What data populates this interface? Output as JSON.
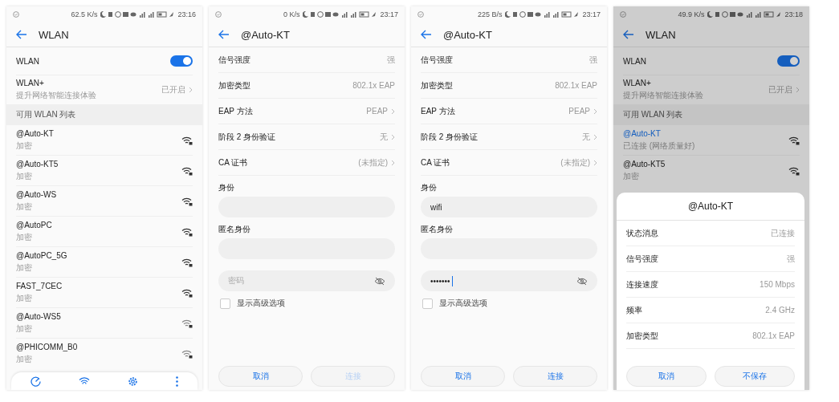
{
  "screens": [
    {
      "kind": "wlan_list",
      "dimmed": false,
      "status_bar": {
        "speed": "62.5 K/s",
        "time": "23:16"
      },
      "title": "WLAN",
      "wlan_toggle": {
        "label": "WLAN",
        "on": true
      },
      "wlan_plus": {
        "label": "WLAN+",
        "subtitle": "提升网络智能连接体验",
        "value": "已开启"
      },
      "section": "可用 WLAN 列表",
      "networks": [
        {
          "name": "@Auto-KT",
          "status": "加密",
          "connected": false
        },
        {
          "name": "@Auto-KT5",
          "status": "加密",
          "connected": false
        },
        {
          "name": "@Auto-WS",
          "status": "加密",
          "connected": false
        },
        {
          "name": "@AutoPC",
          "status": "加密",
          "connected": false
        },
        {
          "name": "@AutoPC_5G",
          "status": "加密",
          "connected": false
        },
        {
          "name": "FAST_7CEC",
          "status": "加密",
          "connected": false
        },
        {
          "name": "@Auto-WS5",
          "status": "加密",
          "connected": false
        },
        {
          "name": "@PHICOMM_B0",
          "status": "加密",
          "connected": false
        }
      ],
      "bottom_toolbar": true
    },
    {
      "kind": "eap_form",
      "status_bar": {
        "speed": "0 K/s",
        "time": "23:17"
      },
      "title": "@Auto-KT",
      "rows": [
        {
          "label": "信号强度",
          "value": "强",
          "chevron": false
        },
        {
          "label": "加密类型",
          "value": "802.1x EAP",
          "chevron": false
        },
        {
          "label": "EAP 方法",
          "value": "PEAP",
          "chevron": true
        },
        {
          "label": "阶段 2 身份验证",
          "value": "无",
          "chevron": true
        },
        {
          "label": "CA 证书",
          "value": "(未指定)",
          "chevron": true
        }
      ],
      "identity": {
        "label": "身份"
      },
      "anonymous": {
        "label": "匿名身份"
      },
      "password": {
        "placeholder": "密码",
        "focused": false
      },
      "advanced": {
        "label": "显示高级选项",
        "checked": false
      },
      "buttons": [
        {
          "label": "取消",
          "disabled": false
        },
        {
          "label": "连接",
          "disabled": true
        }
      ]
    },
    {
      "kind": "eap_form",
      "status_bar": {
        "speed": "225 B/s",
        "time": "23:17"
      },
      "title": "@Auto-KT",
      "rows": [
        {
          "label": "信号强度",
          "value": "强",
          "chevron": false
        },
        {
          "label": "加密类型",
          "value": "802.1x EAP",
          "chevron": false
        },
        {
          "label": "EAP 方法",
          "value": "PEAP",
          "chevron": true
        },
        {
          "label": "阶段 2 身份验证",
          "value": "无",
          "chevron": true
        },
        {
          "label": "CA 证书",
          "value": "(未指定)",
          "chevron": true
        }
      ],
      "identity": {
        "label": "身份",
        "value": "wifi"
      },
      "anonymous": {
        "label": "匿名身份"
      },
      "password": {
        "value": "•••••••",
        "focused": true
      },
      "advanced": {
        "label": "显示高级选项",
        "checked": false
      },
      "buttons": [
        {
          "label": "取消",
          "disabled": false
        },
        {
          "label": "连接",
          "disabled": false
        }
      ]
    },
    {
      "kind": "wlan_list",
      "dimmed": true,
      "status_bar": {
        "speed": "49.9 K/s",
        "time": "23:18"
      },
      "title": "WLAN",
      "wlan_toggle": {
        "label": "WLAN",
        "on": true
      },
      "wlan_plus": {
        "label": "WLAN+",
        "subtitle": "提升网络智能连接体验",
        "value": "已开启"
      },
      "section": "可用 WLAN 列表",
      "networks": [
        {
          "name": "@Auto-KT",
          "status": "已连接 (网络质量好)",
          "connected": true
        },
        {
          "name": "@Auto-KT5",
          "status": "加密",
          "connected": false
        }
      ],
      "dialog": {
        "title": "@Auto-KT",
        "rows": [
          {
            "label": "状态消息",
            "value": "已连接"
          },
          {
            "label": "信号强度",
            "value": "强"
          },
          {
            "label": "连接速度",
            "value": "150 Mbps"
          },
          {
            "label": "频率",
            "value": "2.4 GHz"
          },
          {
            "label": "加密类型",
            "value": "802.1x EAP"
          }
        ],
        "buttons": [
          "取消",
          "不保存"
        ]
      }
    }
  ]
}
